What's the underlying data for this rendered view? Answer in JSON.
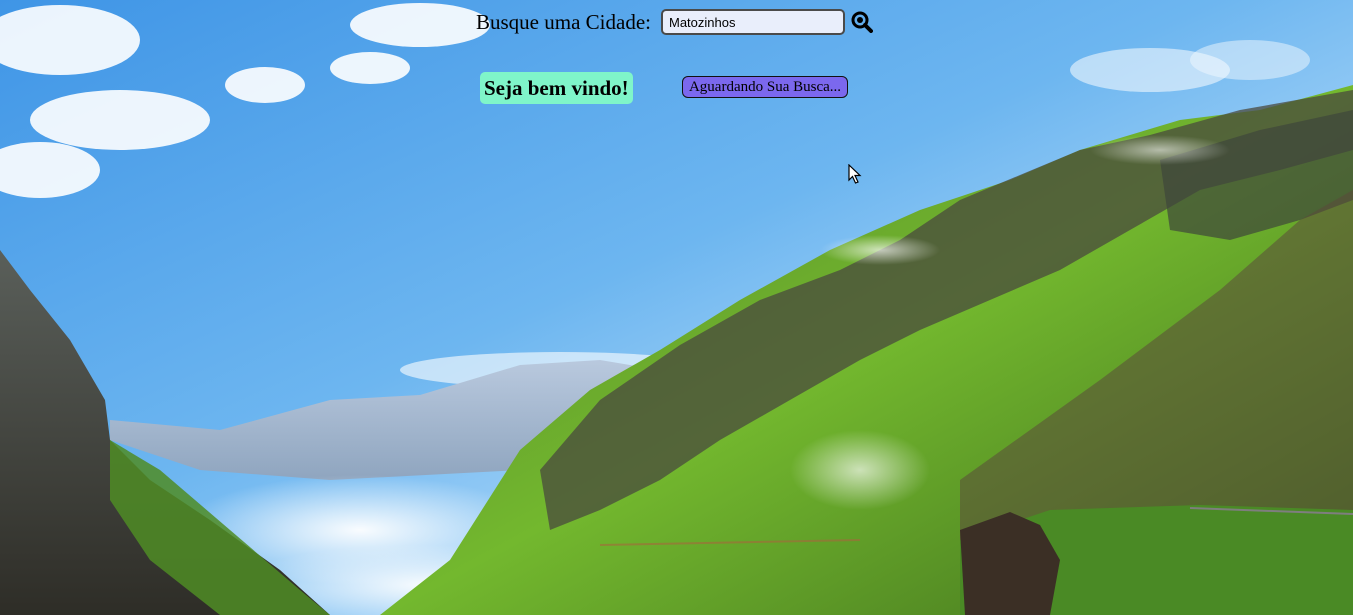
{
  "search": {
    "label": "Busque uma Cidade:",
    "value": "Matozinhos",
    "button_icon": "magnifier-search-icon"
  },
  "welcome": {
    "text": "Seja bem vindo!"
  },
  "status": {
    "text": "Aguardando Sua Busca..."
  },
  "background": {
    "scene": "mountain-valley-landscape",
    "colors": {
      "sky": "#5aa9ec",
      "grass": "#6fbf2c",
      "rock": "#3a3a32",
      "welcome_bg": "#7ff5c9",
      "status_bg": "#7b68ee"
    }
  }
}
